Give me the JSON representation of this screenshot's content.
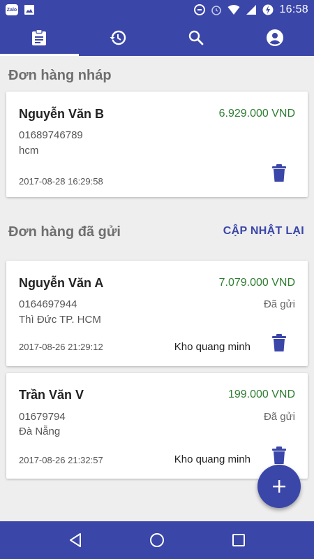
{
  "status_bar": {
    "zalo_label": "Zalo",
    "time": "16:58"
  },
  "tabs": [
    {
      "name": "orders",
      "icon": "clipboard-icon",
      "active": true
    },
    {
      "name": "history",
      "icon": "history-icon",
      "active": false
    },
    {
      "name": "search",
      "icon": "search-icon",
      "active": false
    },
    {
      "name": "account",
      "icon": "account-icon",
      "active": false
    }
  ],
  "drafts": {
    "title": "Đơn hàng nháp",
    "orders": [
      {
        "name": "Nguyễn Văn B",
        "amount": "6.929.000 VND",
        "phone": "01689746789",
        "address": "hcm",
        "timestamp": "2017-08-28 16:29:58"
      }
    ]
  },
  "sent": {
    "title": "Đơn hàng đã gửi",
    "refresh_label": "CẬP NHẬT LẠI",
    "orders": [
      {
        "name": "Nguyễn Văn A",
        "amount": "7.079.000 VND",
        "phone": "0164697944",
        "status": "Đã gửi",
        "address": "Thì Đức TP. HCM",
        "timestamp": "2017-08-26 21:29:12",
        "warehouse": "Kho quang minh"
      },
      {
        "name": "Trần Văn V",
        "amount": "199.000 VND",
        "phone": "01679794",
        "status": "Đã gửi",
        "address": "Đà Nẵng",
        "timestamp": "2017-08-26 21:32:57",
        "warehouse": "Kho quang minh"
      }
    ]
  },
  "colors": {
    "primary": "#3a46a8",
    "amount_green": "#2e7d32",
    "background": "#eeeeee"
  }
}
